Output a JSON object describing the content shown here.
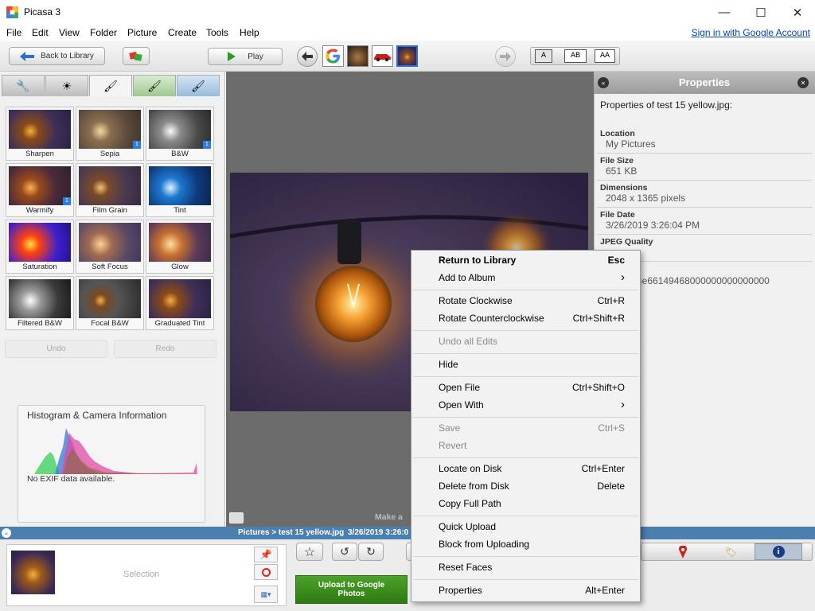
{
  "window": {
    "title": "Picasa 3",
    "controls": {
      "minimize": "—",
      "maximize": "☐",
      "close": "✕"
    }
  },
  "menubar": {
    "items": [
      "File",
      "Edit",
      "View",
      "Folder",
      "Picture",
      "Create",
      "Tools",
      "Help"
    ],
    "signin": "Sign in with Google Account"
  },
  "toolbar": {
    "back_label": "Back to Library",
    "play_label": "Play",
    "text_size_options": [
      "A",
      "AB",
      "AA"
    ]
  },
  "edit_tabs": [
    "basic-fixes",
    "tuning",
    "effects",
    "effects-2",
    "effects-3"
  ],
  "effects": [
    {
      "label": "Sharpen",
      "badge": ""
    },
    {
      "label": "Sepia",
      "badge": "1"
    },
    {
      "label": "B&W",
      "badge": "1"
    },
    {
      "label": "Warmify",
      "badge": "1"
    },
    {
      "label": "Film Grain",
      "badge": ""
    },
    {
      "label": "Tint",
      "badge": ""
    },
    {
      "label": "Saturation",
      "badge": ""
    },
    {
      "label": "Soft Focus",
      "badge": ""
    },
    {
      "label": "Glow",
      "badge": ""
    },
    {
      "label": "Filtered B&W",
      "badge": ""
    },
    {
      "label": "Focal B&W",
      "badge": ""
    },
    {
      "label": "Graduated Tint",
      "badge": ""
    }
  ],
  "undo_label": "Undo",
  "redo_label": "Redo",
  "histogram": {
    "title": "Histogram & Camera Information",
    "note": "No EXIF data available."
  },
  "properties": {
    "title": "Properties",
    "subtitle": "Properties of test 15 yellow.jpg:",
    "rows": [
      {
        "key": "Location",
        "value": "My Pictures"
      },
      {
        "key": "File Size",
        "value": "651 KB"
      },
      {
        "key": "Dimensions",
        "value": "2048 x 1365 pixels"
      },
      {
        "key": "File Date",
        "value": "3/26/2019 3:26:04 PM"
      },
      {
        "key": "JPEG Quality",
        "value": ""
      }
    ],
    "truncated_value": "4e66149468000000000000000"
  },
  "caption_partial": "Make a",
  "statusbar": {
    "path": "Pictures > test 15 yellow.jpg",
    "date": "3/26/2019 3:26:0"
  },
  "bottom": {
    "selection_label": "Selection",
    "upload_label_line1": "Upload to Google",
    "upload_label_line2": "Photos"
  },
  "context_menu": {
    "items": [
      {
        "label": "Return to Library",
        "shortcut": "Esc",
        "bold": true,
        "disabled": false,
        "submenu": false
      },
      {
        "label": "Add to Album",
        "shortcut": "",
        "bold": false,
        "disabled": false,
        "submenu": true
      },
      {
        "label": "Rotate Clockwise",
        "shortcut": "Ctrl+R",
        "bold": false,
        "disabled": false,
        "submenu": false
      },
      {
        "label": "Rotate Counterclockwise",
        "shortcut": "Ctrl+Shift+R",
        "bold": false,
        "disabled": false,
        "submenu": false
      },
      {
        "label": "Undo all Edits",
        "shortcut": "",
        "bold": false,
        "disabled": true,
        "submenu": false
      },
      {
        "label": "Hide",
        "shortcut": "",
        "bold": false,
        "disabled": false,
        "submenu": false
      },
      {
        "label": "Open File",
        "shortcut": "Ctrl+Shift+O",
        "bold": false,
        "disabled": false,
        "submenu": false
      },
      {
        "label": "Open With",
        "shortcut": "",
        "bold": false,
        "disabled": false,
        "submenu": true
      },
      {
        "label": "Save",
        "shortcut": "Ctrl+S",
        "bold": false,
        "disabled": true,
        "submenu": false
      },
      {
        "label": "Revert",
        "shortcut": "",
        "bold": false,
        "disabled": true,
        "submenu": false
      },
      {
        "label": "Locate on Disk",
        "shortcut": "Ctrl+Enter",
        "bold": false,
        "disabled": false,
        "submenu": false
      },
      {
        "label": "Delete from Disk",
        "shortcut": "Delete",
        "bold": false,
        "disabled": false,
        "submenu": false
      },
      {
        "label": "Copy Full Path",
        "shortcut": "",
        "bold": false,
        "disabled": false,
        "submenu": false
      },
      {
        "label": "Quick Upload",
        "shortcut": "",
        "bold": false,
        "disabled": false,
        "submenu": false
      },
      {
        "label": "Block from Uploading",
        "shortcut": "",
        "bold": false,
        "disabled": false,
        "submenu": false
      },
      {
        "label": "Reset Faces",
        "shortcut": "",
        "bold": false,
        "disabled": false,
        "submenu": false
      },
      {
        "label": "Properties",
        "shortcut": "Alt+Enter",
        "bold": false,
        "disabled": false,
        "submenu": false
      }
    ]
  },
  "colors": {
    "statusbar": "#4a7fae",
    "upload_button": "#3d8f1c",
    "link": "#0645ad"
  }
}
